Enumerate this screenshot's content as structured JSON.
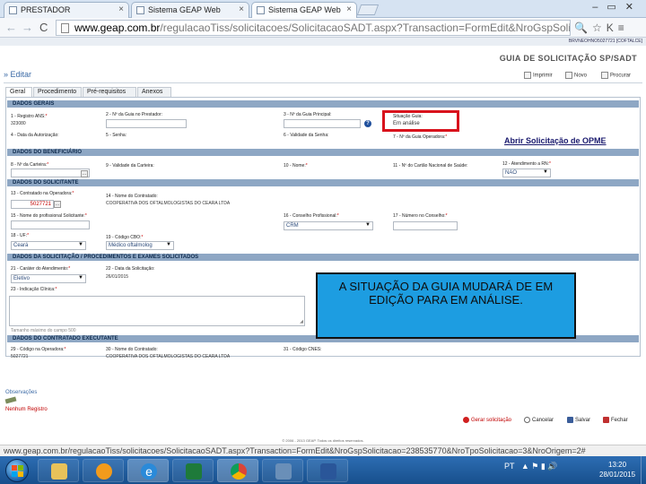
{
  "browser": {
    "tabs": [
      {
        "label": "PRESTADOR"
      },
      {
        "label": "Sistema GEAP Web"
      },
      {
        "label": "Sistema GEAP Web"
      }
    ],
    "url_host": "www.geap.com.br",
    "url_path": "/regulacaoTiss/solicitacoes/SolicitacaoSADT.aspx?Transaction=FormEdit&NroGspSolicitacao=23",
    "status_url": "www.geap.com.br/regulacaoTiss/solicitacoes/SolicitacaoSADT.aspx?Transaction=FormEdit&NroGspSolicitacao=238535770&NroTpoSolicitacao=3&NroOrigem=2#"
  },
  "header": {
    "user_info": "BRVNEOHNO5027721 [COFTALCE]",
    "guide_title": "GUIA DE SOLICITAÇÃO SP/SADT",
    "mode": "» Editar",
    "actions": {
      "print": "Imprimir",
      "new": "Novo",
      "search": "Procurar"
    }
  },
  "tabs": [
    "Geral",
    "Procedimento",
    "Pré-requisitos",
    "Anexos"
  ],
  "sections": {
    "general": "DADOS GERAIS",
    "beneficiary": "DADOS DO BENEFICIÁRIO",
    "requester": "DADOS DO SOLICITANTE",
    "procedures": "DADOS DA SOLICITAÇÃO / PROCEDIMENTOS E EXAMES SOLICITADOS",
    "executor": "DADOS DO CONTRATADO EXECUTANTE"
  },
  "fields": {
    "registro_ans": {
      "label": "1 - Registro ANS:",
      "value": "323080"
    },
    "nro_guia_prestador": {
      "label": "2 - Nº da Guia no Prestador:"
    },
    "nro_guia_principal": {
      "label": "3 - Nº da Guia Principal:"
    },
    "situacao_guia": {
      "label": "Situação Guia:",
      "value": "Em análise"
    },
    "data_autorizacao": {
      "label": "4 - Data da Autorização:"
    },
    "senha": {
      "label": "5 - Senha:"
    },
    "validade_senha": {
      "label": "6 - Validade da Senha:"
    },
    "nro_guia_operadora": {
      "label": "7 - Nº da Guia Operadora:"
    },
    "nro_carteira": {
      "label": "8 - Nº da Carteira:"
    },
    "validade_carteira": {
      "label": "9 - Validade da Carteira:"
    },
    "nome": {
      "label": "10 - Nome:"
    },
    "cartao_nacional_saude": {
      "label": "11 - Nº do Cartão Nacional de Saúde:"
    },
    "atendimento_rn": {
      "label": "12 - Atendimento a RN:",
      "value": "NAO"
    },
    "contratado_operadora": {
      "label": "13 - Contratado na Operadora:",
      "value": "5027721"
    },
    "nome_contratado": {
      "label": "14 - Nome do Contratado:",
      "value": "COOPERATIVA DOS OFTALMOLOGISTAS DO CEARA LTDA"
    },
    "profissional_solicitante": {
      "label": "15 - Nome do profissional Solicitante:"
    },
    "conselho_profissional": {
      "label": "16 - Conselho Profissional:",
      "value": "CRM"
    },
    "numero_conselho": {
      "label": "17 - Número no Conselho:"
    },
    "uf": {
      "label": "18 - UF:",
      "value": "Ceará"
    },
    "codigo_cbo": {
      "label": "19 - Código CBO:",
      "value": "Médico oftalmolog"
    },
    "carater_atendimento": {
      "label": "21 - Caráter do Atendimento:",
      "value": "Eletivo"
    },
    "data_solicitacao": {
      "label": "22 - Data da Solicitação:",
      "value": "26/01/2015"
    },
    "indicacao_clinica": {
      "label": "23 - Indicação Clínica:",
      "hint": "Tamanho máximo do campo 500"
    },
    "codigo_operadora": {
      "label": "29 - Código na Operadora:",
      "value": "5027721"
    },
    "nome_contratado_exec": {
      "label": "30 - Nome do Contratado:",
      "value": "COOPERATIVA DOS OFTALMOLOGISTAS DO CEARA LTDA"
    },
    "codigo_cnes": {
      "label": "31 - Código CNES:"
    }
  },
  "opme_link": "Abrir Solicitação de OPME",
  "callout": "A SITUAÇÃO DA GUIA MUDARÁ DE EM EDIÇÃO PARA EM ANÁLISE.",
  "observations": {
    "label": "Observações",
    "empty": "Nenhum Registro"
  },
  "bottom_actions": {
    "generate": "Gerar solicitação",
    "cancel": "Cancelar",
    "save": "Salvar",
    "close": "Fechar"
  },
  "footer": "© 2006 - 2013 GEAP. Todos os direitos reservados.",
  "taskbar": {
    "lang": "PT",
    "time": "13:20",
    "date": "28/01/2015"
  },
  "colors": {
    "section_bg": "#8ea7c4",
    "highlight": "#d8121c",
    "callout_bg": "#1d9de1",
    "link": "#3b6aa6"
  }
}
